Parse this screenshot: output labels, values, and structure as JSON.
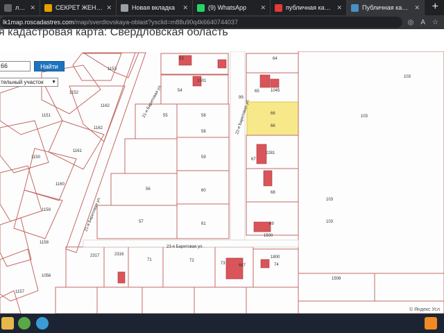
{
  "browser": {
    "tabs": [
      {
        "title": "латформа д",
        "icon": "generic-page-icon",
        "color": "#5f6368",
        "width": 58,
        "active": false
      },
      {
        "title": "СЕКРЕТ ЖЕНЩИНЫ |",
        "icon": "youtube-icon",
        "color": "#e8a000",
        "width": 110,
        "active": false
      },
      {
        "title": "Новая вкладка",
        "icon": "new-tab-icon",
        "color": "#9aa0a6",
        "width": 110,
        "active": false
      },
      {
        "title": "(9) WhatsApp",
        "icon": "whatsapp-icon",
        "color": "#25d366",
        "width": 112,
        "active": false
      },
      {
        "title": "публичная кадастро",
        "icon": "yandex-icon",
        "color": "#e53935",
        "width": 110,
        "active": false
      },
      {
        "title": "Публичная кадастро",
        "icon": "rosreestr-icon",
        "color": "#4a90c2",
        "width": 112,
        "active": true
      }
    ],
    "url_host": "lk1map.roscadastres.com",
    "url_path": "/map/sverdlovskaya-oblast?ysclid=m88u90q4k6640744037"
  },
  "page": {
    "heading": "я кадастровая карта: Свердловская область",
    "search_value": "66",
    "search_button": "Найти",
    "select_value": "тельный участок"
  },
  "map": {
    "parcel_labels": [
      "53",
      "1153",
      "64",
      "103",
      "1152",
      "54",
      "1501",
      "65",
      "1045",
      "99",
      "1162",
      "55",
      "58",
      "66",
      "66",
      "1151",
      "58",
      "1162",
      "1161",
      "1150",
      "59",
      "67",
      "2281",
      "1160",
      "56",
      "60",
      "68",
      "1159",
      "57",
      "61",
      "69",
      "1500",
      "1158",
      "23-я Баритовая ул.",
      "2317",
      "2316",
      "71",
      "72",
      "73",
      "667",
      "1800",
      "74",
      "1157",
      "1508",
      "1056",
      "22-я Баритовая ул.",
      "21-я Баритовая ул.",
      "21-я Баритовая ул.",
      "103",
      "103",
      "103"
    ],
    "highlight_color": "#f7e98a",
    "parcel_color": "#c26a66",
    "building_color": "#d9555a"
  },
  "attribution": "© Яндекс Усл"
}
